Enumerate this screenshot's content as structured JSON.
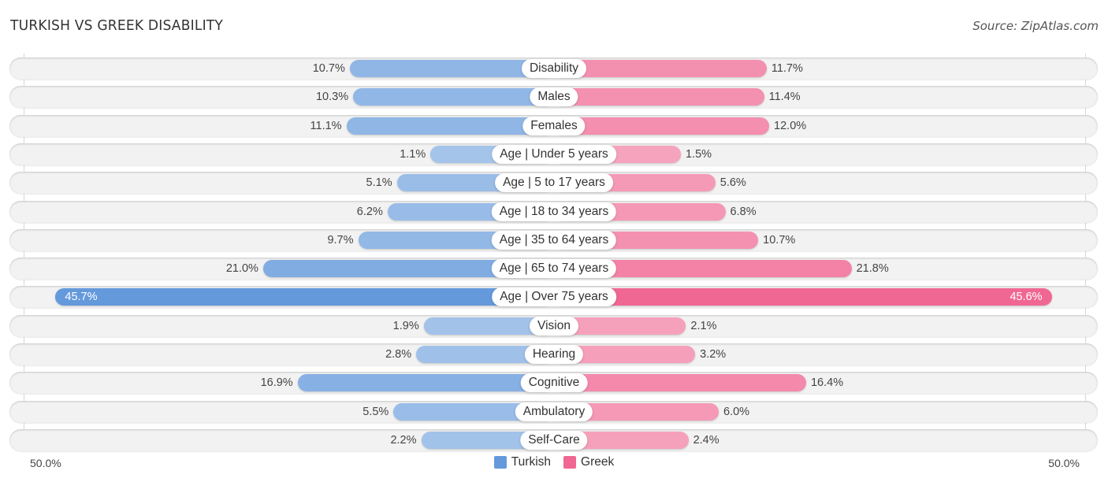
{
  "header": {
    "title": "TURKISH VS GREEK DISABILITY",
    "source": "Source: ZipAtlas.com"
  },
  "colors": {
    "turkish_full": "#6499dc",
    "turkish_light": "#a9c7eb",
    "greek_full": "#f06793",
    "greek_light": "#f7a9c1"
  },
  "chart_data": {
    "type": "bar",
    "orientation": "horizontal-diverging",
    "title": "TURKISH VS GREEK DISABILITY",
    "categories": [
      "Disability",
      "Males",
      "Females",
      "Age | Under 5 years",
      "Age | 5 to 17 years",
      "Age | 18 to 34 years",
      "Age | 35 to 64 years",
      "Age | 65 to 74 years",
      "Age | Over 75 years",
      "Vision",
      "Hearing",
      "Cognitive",
      "Ambulatory",
      "Self-Care"
    ],
    "series": [
      {
        "name": "Turkish",
        "side": "left",
        "values": [
          10.7,
          10.3,
          11.1,
          1.1,
          5.1,
          6.2,
          9.7,
          21.0,
          45.7,
          1.9,
          2.8,
          16.9,
          5.5,
          2.2
        ],
        "labels": [
          "10.7%",
          "10.3%",
          "11.1%",
          "1.1%",
          "5.1%",
          "6.2%",
          "9.7%",
          "21.0%",
          "45.7%",
          "1.9%",
          "2.8%",
          "16.9%",
          "5.5%",
          "2.2%"
        ]
      },
      {
        "name": "Greek",
        "side": "right",
        "values": [
          11.7,
          11.4,
          12.0,
          1.5,
          5.6,
          6.8,
          10.7,
          21.8,
          45.6,
          2.1,
          3.2,
          16.4,
          6.0,
          2.4
        ],
        "labels": [
          "11.7%",
          "11.4%",
          "12.0%",
          "1.5%",
          "5.6%",
          "6.8%",
          "10.7%",
          "21.8%",
          "45.6%",
          "2.1%",
          "3.2%",
          "16.4%",
          "6.0%",
          "2.4%"
        ]
      }
    ],
    "xlim": [
      -50,
      50
    ],
    "axis_labels": {
      "left": "50.0%",
      "right": "50.0%"
    },
    "legend": {
      "position": "bottom-center",
      "entries": [
        "Turkish",
        "Greek"
      ]
    },
    "grid": false
  }
}
